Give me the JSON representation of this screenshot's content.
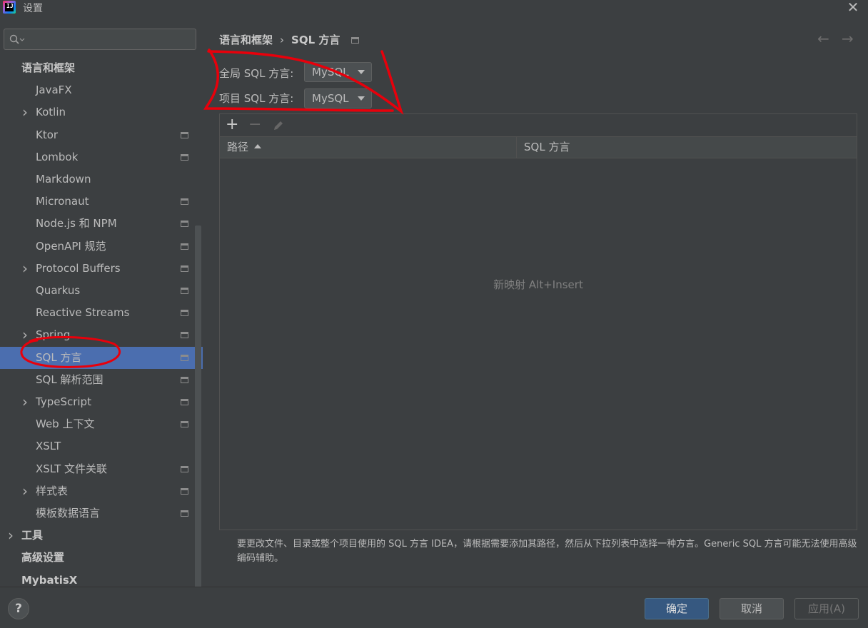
{
  "window": {
    "title": "设置"
  },
  "search": {
    "placeholder": "",
    "value": ""
  },
  "sidebar": {
    "items": [
      {
        "label": "语言和框架",
        "level": 0,
        "bold": true,
        "expandable": false,
        "project_icon": false
      },
      {
        "label": "JavaFX",
        "level": 1,
        "expandable": false,
        "project_icon": false
      },
      {
        "label": "Kotlin",
        "level": 1,
        "expandable": true,
        "project_icon": false
      },
      {
        "label": "Ktor",
        "level": 1,
        "expandable": false,
        "project_icon": true
      },
      {
        "label": "Lombok",
        "level": 1,
        "expandable": false,
        "project_icon": true
      },
      {
        "label": "Markdown",
        "level": 1,
        "expandable": false,
        "project_icon": false
      },
      {
        "label": "Micronaut",
        "level": 1,
        "expandable": false,
        "project_icon": true
      },
      {
        "label": "Node.js 和 NPM",
        "level": 1,
        "expandable": false,
        "project_icon": true
      },
      {
        "label": "OpenAPI 规范",
        "level": 1,
        "expandable": false,
        "project_icon": true
      },
      {
        "label": "Protocol Buffers",
        "level": 1,
        "expandable": true,
        "project_icon": true
      },
      {
        "label": "Quarkus",
        "level": 1,
        "expandable": false,
        "project_icon": true
      },
      {
        "label": "Reactive Streams",
        "level": 1,
        "expandable": false,
        "project_icon": true
      },
      {
        "label": "Spring",
        "level": 1,
        "expandable": true,
        "project_icon": true
      },
      {
        "label": "SQL 方言",
        "level": 1,
        "expandable": false,
        "project_icon": true,
        "selected": true
      },
      {
        "label": "SQL 解析范围",
        "level": 1,
        "expandable": false,
        "project_icon": true
      },
      {
        "label": "TypeScript",
        "level": 1,
        "expandable": true,
        "project_icon": true
      },
      {
        "label": "Web 上下文",
        "level": 1,
        "expandable": false,
        "project_icon": true
      },
      {
        "label": "XSLT",
        "level": 1,
        "expandable": false,
        "project_icon": false
      },
      {
        "label": "XSLT 文件关联",
        "level": 1,
        "expandable": false,
        "project_icon": true
      },
      {
        "label": "样式表",
        "level": 1,
        "expandable": true,
        "project_icon": true
      },
      {
        "label": "模板数据语言",
        "level": 1,
        "expandable": false,
        "project_icon": true
      },
      {
        "label": "工具",
        "level": 0,
        "bold": true,
        "expandable": true,
        "project_icon": false
      },
      {
        "label": "高级设置",
        "level": 0,
        "bold": true,
        "expandable": false,
        "project_icon": false
      },
      {
        "label": "MybatisX",
        "level": 0,
        "bold": true,
        "expandable": false,
        "project_icon": false
      }
    ]
  },
  "breadcrumb": {
    "parent": "语言和框架",
    "separator": "›",
    "current": "SQL 方言"
  },
  "nav": {
    "back": "←",
    "forward": "→"
  },
  "settings": {
    "global_label": "全局 SQL 方言:",
    "global_value": "MySQL",
    "project_label": "项目 SQL 方言:",
    "project_value": "MySQL"
  },
  "table": {
    "toolbar": {
      "add": "+",
      "remove": "−"
    },
    "columns": [
      "路径",
      "SQL 方言"
    ],
    "empty_text": "新映射 Alt+Insert"
  },
  "hint": "要更改文件、目录或整个项目使用的 SQL 方言 IDEA，请根据需要添加其路径，然后从下拉列表中选择一种方言。Generic SQL 方言可能无法使用高级编码辅助。",
  "footer": {
    "help": "?",
    "ok": "确定",
    "cancel": "取消",
    "apply": "应用(A)"
  },
  "colors": {
    "background": "#3c3f41",
    "selection": "#4b6eaf",
    "primary_button": "#365880",
    "annotation": "#e8000b"
  },
  "icons": [
    "search-icon",
    "close-icon",
    "project-scope-icon",
    "chevron-right-icon",
    "edit-pencil-icon",
    "help-icon"
  ]
}
